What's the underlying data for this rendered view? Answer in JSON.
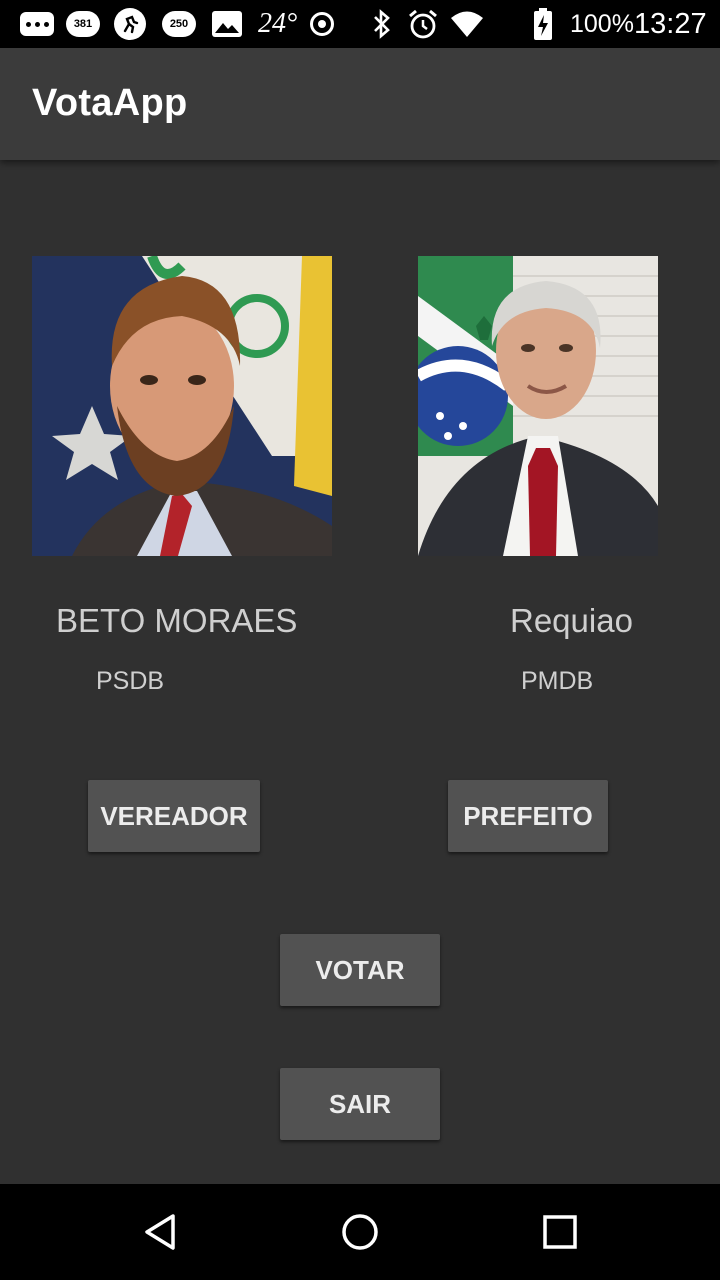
{
  "status_bar": {
    "notification_icons": [
      "chat-dots-icon",
      "mail-count-icon",
      "activity-icon",
      "mail-count-icon",
      "image-icon"
    ],
    "badge_1": "381",
    "badge_2": "250",
    "temperature": "24°",
    "battery_percent": "100%",
    "time": "13:27"
  },
  "app_bar": {
    "title": "VotaApp"
  },
  "candidates": [
    {
      "name": "BETO MORAES",
      "party": "PSDB",
      "role_button": "VEREADOR"
    },
    {
      "name": "Requiao",
      "party": "PMDB",
      "role_button": "PREFEITO"
    }
  ],
  "actions": {
    "vote_label": "VOTAR",
    "exit_label": "SAIR"
  },
  "nav_bar": {
    "back": "back-icon",
    "home": "home-icon",
    "recents": "recents-icon"
  },
  "colors": {
    "background": "#303030",
    "app_bar": "#3b3b3b",
    "button": "#525252",
    "text": "#dcdcdc"
  }
}
